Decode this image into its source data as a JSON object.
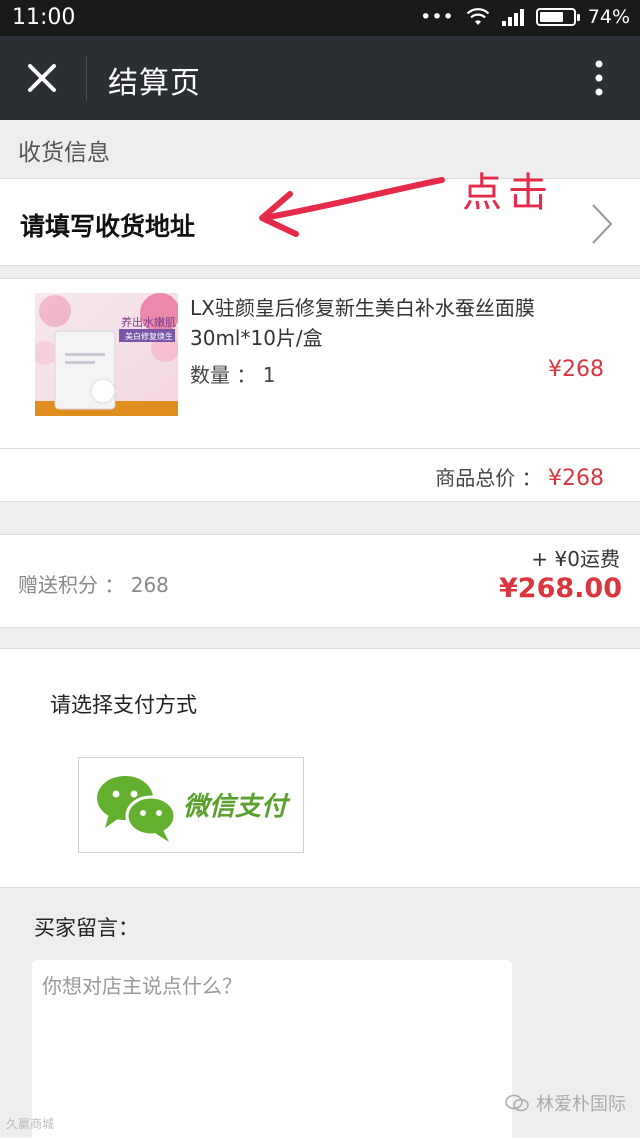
{
  "status_bar": {
    "time": "11:00",
    "battery": "74%",
    "battery_level": 0.74
  },
  "header": {
    "title": "结算页"
  },
  "shipping": {
    "section_title": "收货信息",
    "address_prompt": "请填写收货地址",
    "annotation": "点击"
  },
  "product": {
    "name": "LX驻颜皇后修复新生美白补水蚕丝面膜30ml*10片/盒",
    "quantity": "数量 ： 1",
    "price": "¥268",
    "thumb_text": "养出水嫩肌",
    "thumb_sub": "美白修复焕生"
  },
  "subtotal": {
    "label": "商品总价 ：",
    "amount": "¥268"
  },
  "summary": {
    "points": "赠送积分 ： 268",
    "shipping_fee": "+ ¥0运费",
    "grand_total": "¥268.00"
  },
  "payment": {
    "label": "请选择支付方式",
    "method": "微信支付"
  },
  "message": {
    "label": "买家留言：",
    "placeholder": "你想对店主说点什么？"
  },
  "watermarks": {
    "left": "久赢商城",
    "right": "林爱朴国际"
  },
  "colors": {
    "accent_red": "#d9363e",
    "wechat_green": "#5aa02c",
    "annotation_red": "#e52a4a",
    "nav_bg": "#2b2e33"
  }
}
